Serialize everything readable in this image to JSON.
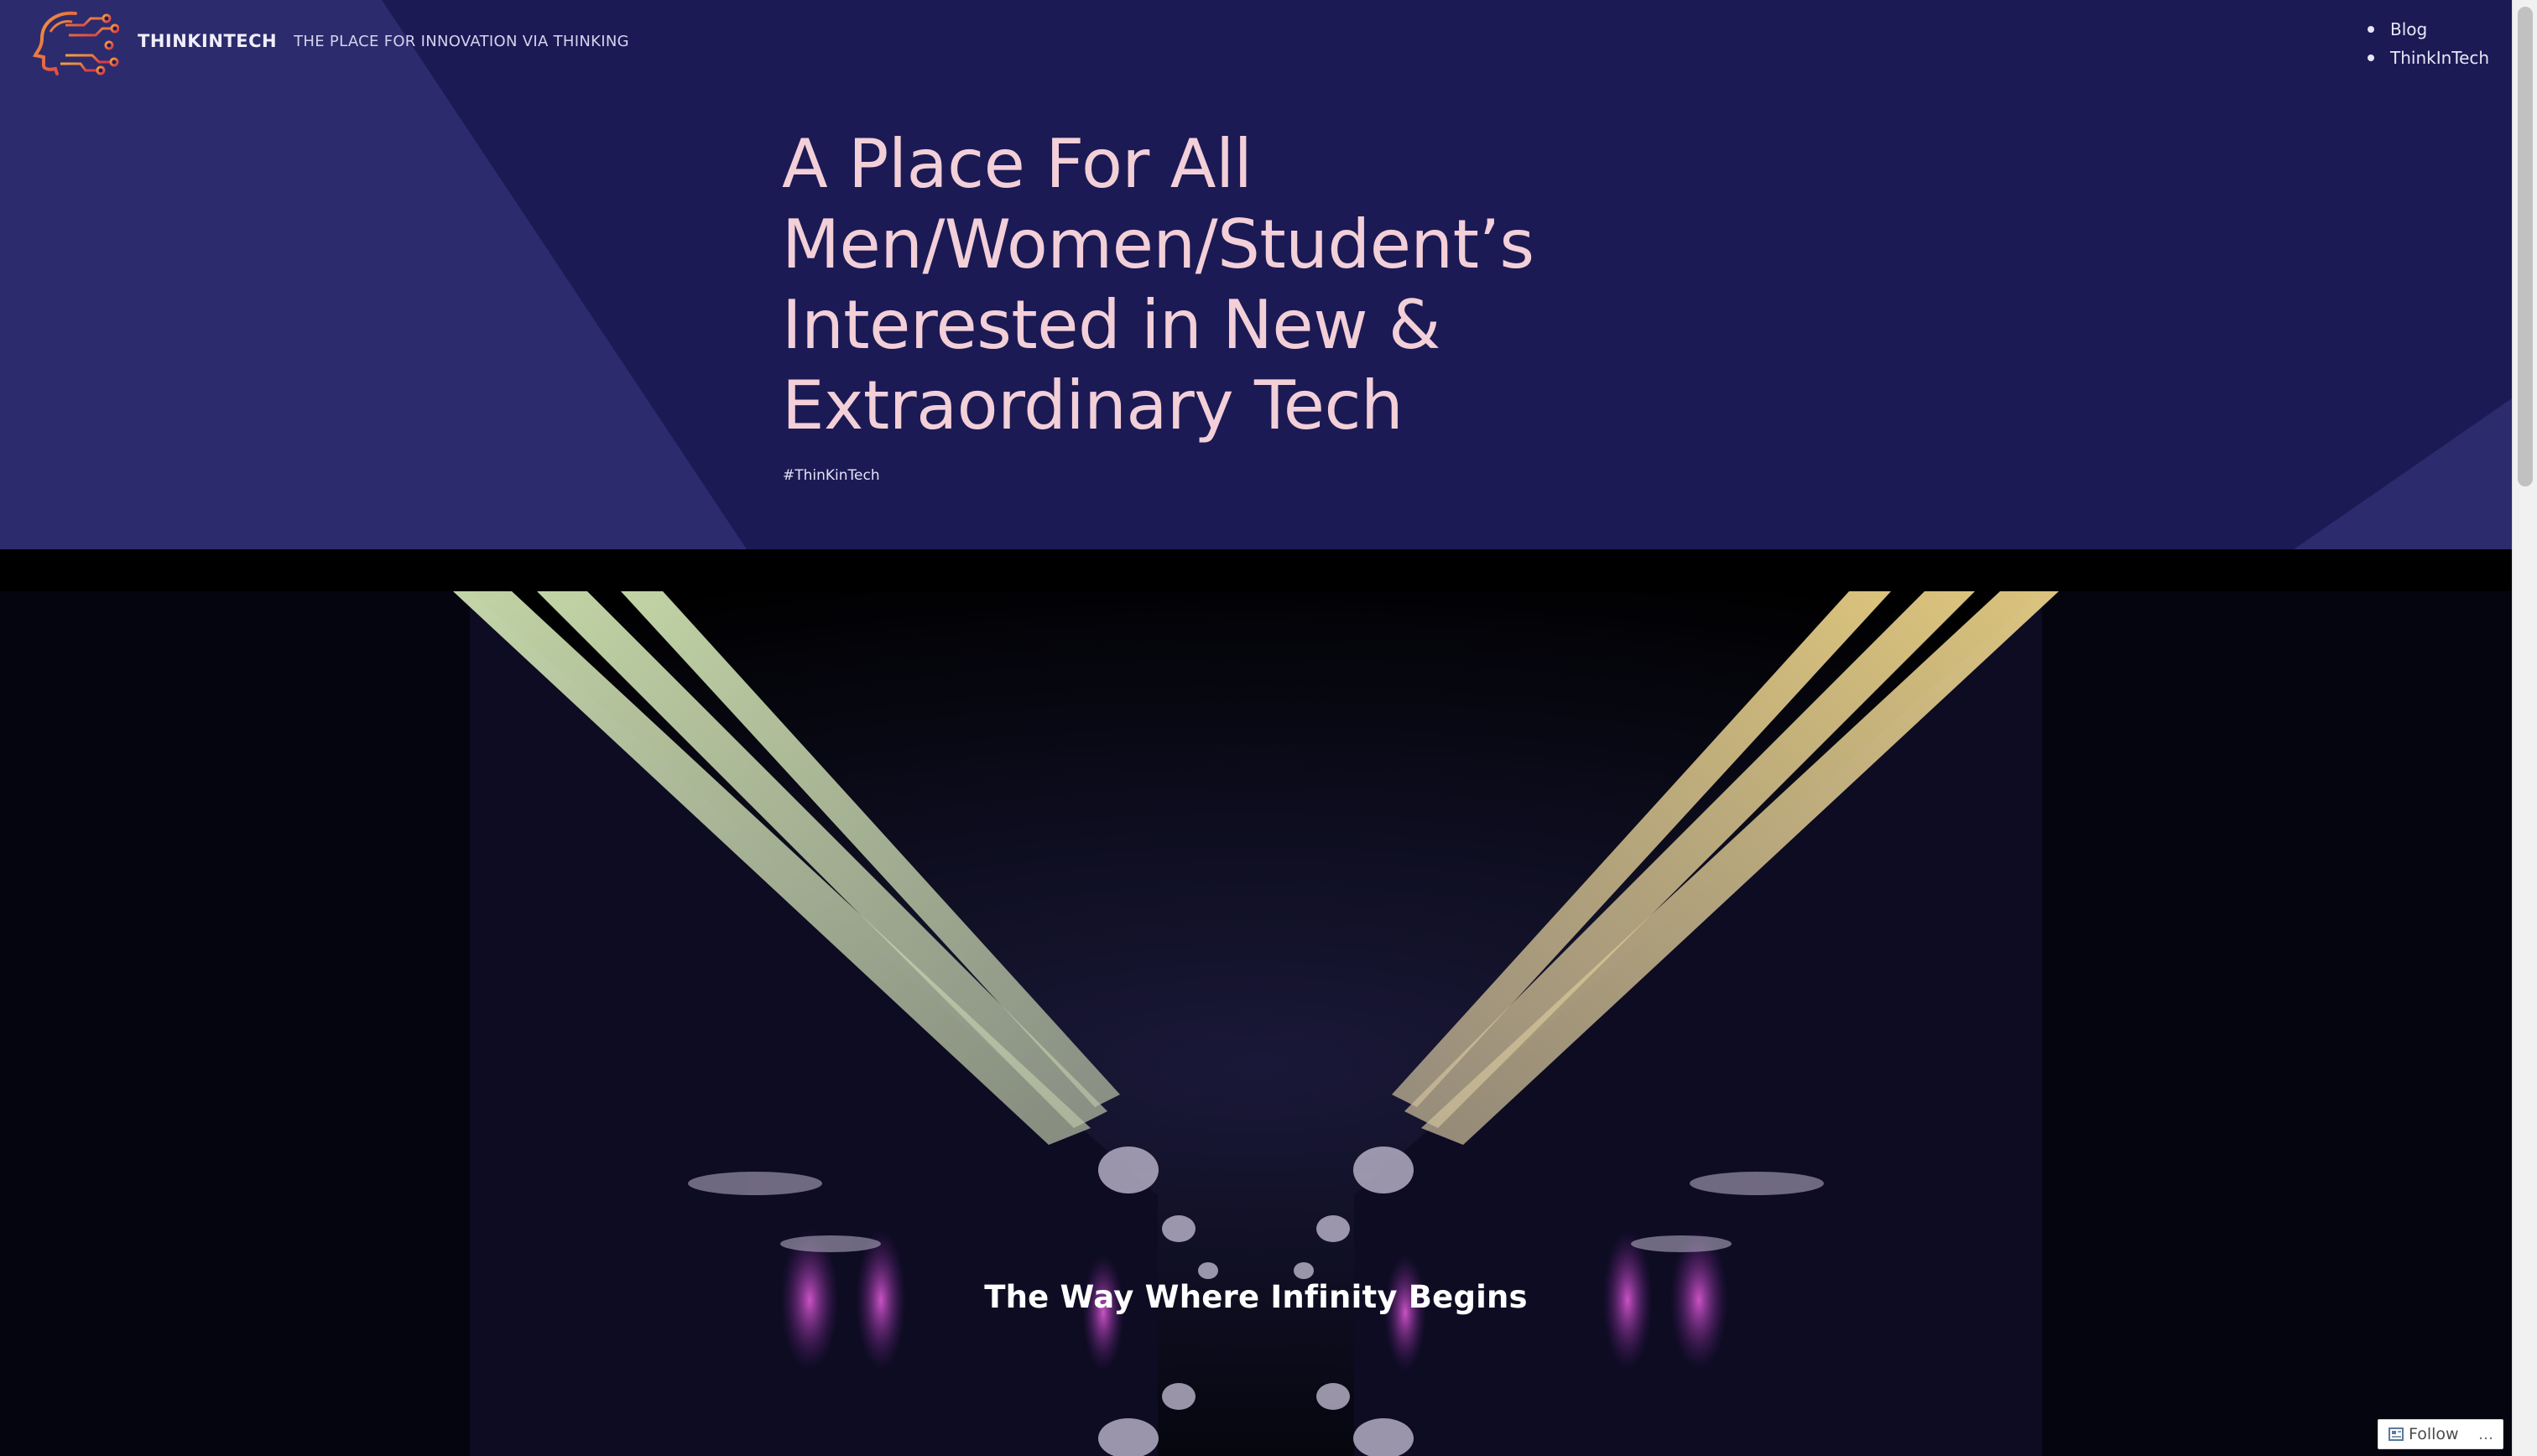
{
  "header": {
    "site_title": "THINKINTECH",
    "tagline": "THE PLACE FOR INNOVATION VIA THINKING",
    "logo_icon": "circuit-head-logo"
  },
  "nav": {
    "items": [
      {
        "label": "Blog"
      },
      {
        "label": "ThinkInTech"
      }
    ]
  },
  "hero": {
    "heading": "A Place For All Men/Women/Student’s Interested in New & Extraordinary Tech",
    "hashtag": "#ThinKinTech"
  },
  "cover": {
    "caption": "The Way Where Infinity Begins"
  },
  "follow_widget": {
    "label": "Follow",
    "more": "…",
    "icon": "reader-follow-icon"
  },
  "colors": {
    "hero_background": "#1b1a55",
    "hero_triangle": "#2c2b6d",
    "heading": "#f3cfd8",
    "cover_background": "#000000"
  }
}
